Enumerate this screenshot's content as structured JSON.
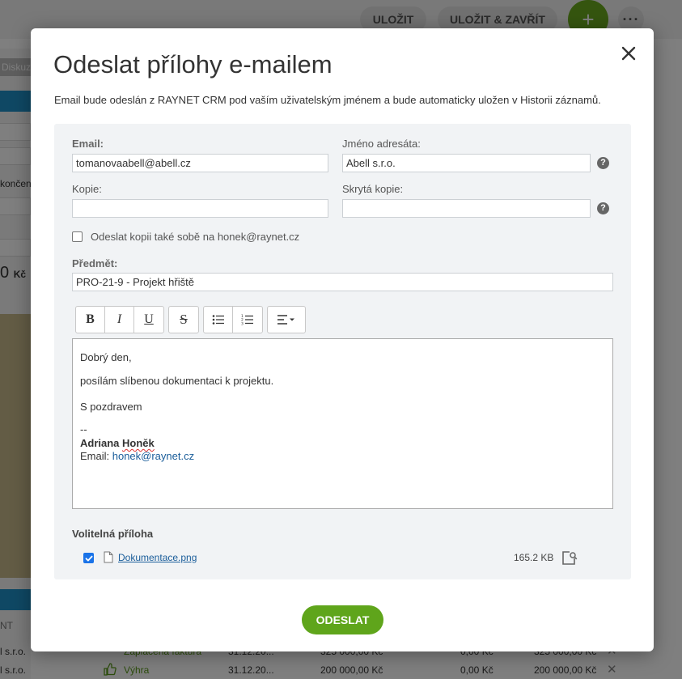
{
  "background": {
    "save_label": "ULOŽIT",
    "save_close_label": "ULOŽIT & ZAVŘÍT",
    "add_label": "+",
    "more_label": "···",
    "diskuz_tab": "Diskuz",
    "konc_text": "končen",
    "amount_text": "0",
    "amount_unit": "Kč",
    "col_header": "NT",
    "rows": [
      {
        "name": "l s.r.o.",
        "status": "Zaplacená faktura",
        "date": "31.12.20...",
        "amount": "325 000,00 Kč",
        "zero": "0,00 Kč",
        "total": "325 000,00 Kč"
      },
      {
        "name": "l s.r.o.",
        "status": "Výhra",
        "date": "31.12.20...",
        "amount": "200 000,00 Kč",
        "zero": "0,00 Kč",
        "total": "200 000,00 Kč"
      }
    ]
  },
  "modal": {
    "title": "Odeslat přílohy e-mailem",
    "description": "Email bude odeslán z RAYNET CRM pod vaším uživatelským jménem a bude automaticky uložen v Historii záznamů.",
    "email_label": "Email:",
    "email_value": "tomanovaabell@abell.cz",
    "recipient_label": "Jméno adresáta:",
    "recipient_value": "Abell s.r.o.",
    "cc_label": "Kopie:",
    "cc_value": "",
    "bcc_label": "Skrytá kopie:",
    "bcc_value": "",
    "self_copy_label": "Odeslat kopii také sobě na honek@raynet.cz",
    "subject_label": "Předmět:",
    "subject_value": "PRO-21-9 - Projekt hřiště",
    "toolbar": {
      "bold": "B",
      "italic": "I",
      "underline": "U",
      "strike": "S"
    },
    "body": {
      "greeting": "Dobrý den,",
      "text": "posílám slíbenou dokumentaci k projektu.",
      "closing": "S pozdravem",
      "separator": "--",
      "signature_first": "Adriana",
      "signature_last": "Honěk",
      "email_prefix": "Email: ",
      "email_link": "honek@raynet.cz"
    },
    "attachment_title": "Volitelná příloha",
    "attachment": {
      "name": "Dokumentace.png",
      "size": "165.2 KB",
      "checked": true
    },
    "send_label": "ODESLAT"
  }
}
